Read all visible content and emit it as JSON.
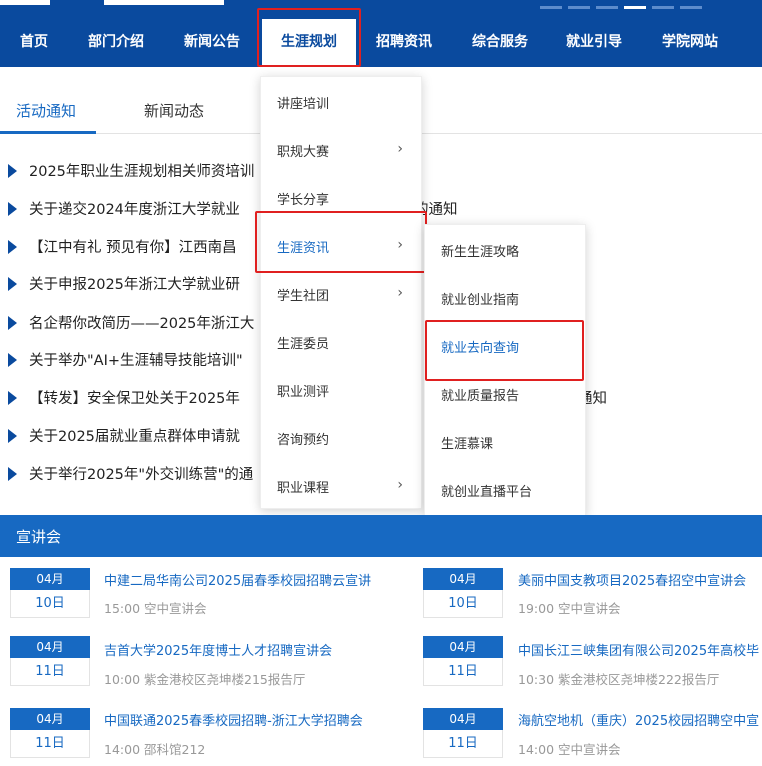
{
  "nav": {
    "items": [
      "首页",
      "部门介绍",
      "新闻公告",
      "生涯规划",
      "招聘资讯",
      "综合服务",
      "就业引导",
      "学院网站"
    ]
  },
  "tabs": [
    "活动通知",
    "新闻动态"
  ],
  "news": [
    "2025年职业生涯规划相关师资培训",
    "关于递交2024年度浙江大学就业",
    "【江中有礼 预见有你】江西南昌",
    "关于申报2025年浙江大学就业研",
    "名企帮你改简历——2025年浙江大",
    "关于举办\"AI+生涯辅导技能培训\"",
    "【转发】安全保卫处关于2025年",
    "关于2025届就业重点群体申请就",
    "关于举行2025年\"外交训练营\"的通"
  ],
  "news_tails": {
    "1": "的通知",
    "6": "通知"
  },
  "menu": {
    "items": [
      "讲座培训",
      "职规大赛",
      "学长分享",
      "生涯资讯",
      "学生社团",
      "生涯委员",
      "职业测评",
      "咨询预约",
      "职业课程"
    ]
  },
  "submenu": {
    "items": [
      "新生生涯攻略",
      "就业创业指南",
      "就业去向查询",
      "就业质量报告",
      "生涯慕课",
      "就创业直播平台"
    ]
  },
  "lectures": {
    "title": "宣讲会",
    "events": [
      {
        "month": "04月",
        "day": "10日",
        "title": "中建二局华南公司2025届春季校园招聘云宣讲",
        "meta": "15:00 空中宣讲会"
      },
      {
        "month": "04月",
        "day": "10日",
        "title": "美丽中国支教项目2025春招空中宣讲会",
        "meta": "19:00 空中宣讲会"
      },
      {
        "month": "04月",
        "day": "11日",
        "title": "吉首大学2025年度博士人才招聘宣讲会",
        "meta": "10:00 紫金港校区尧坤楼215报告厅"
      },
      {
        "month": "04月",
        "day": "11日",
        "title": "中国长江三峡集团有限公司2025年高校毕",
        "meta": "10:30 紫金港校区尧坤楼222报告厅"
      },
      {
        "month": "04月",
        "day": "11日",
        "title": "中国联通2025春季校园招聘-浙江大学招聘会",
        "meta": "14:00 邵科馆212"
      },
      {
        "month": "04月",
        "day": "11日",
        "title": "海航空地机（重庆）2025校园招聘空中宣",
        "meta": "14:00 空中宣讲会"
      }
    ]
  },
  "colors": {
    "brand": "#0a4a9e",
    "accent": "#1769c2",
    "highlight_border": "#e02020"
  }
}
